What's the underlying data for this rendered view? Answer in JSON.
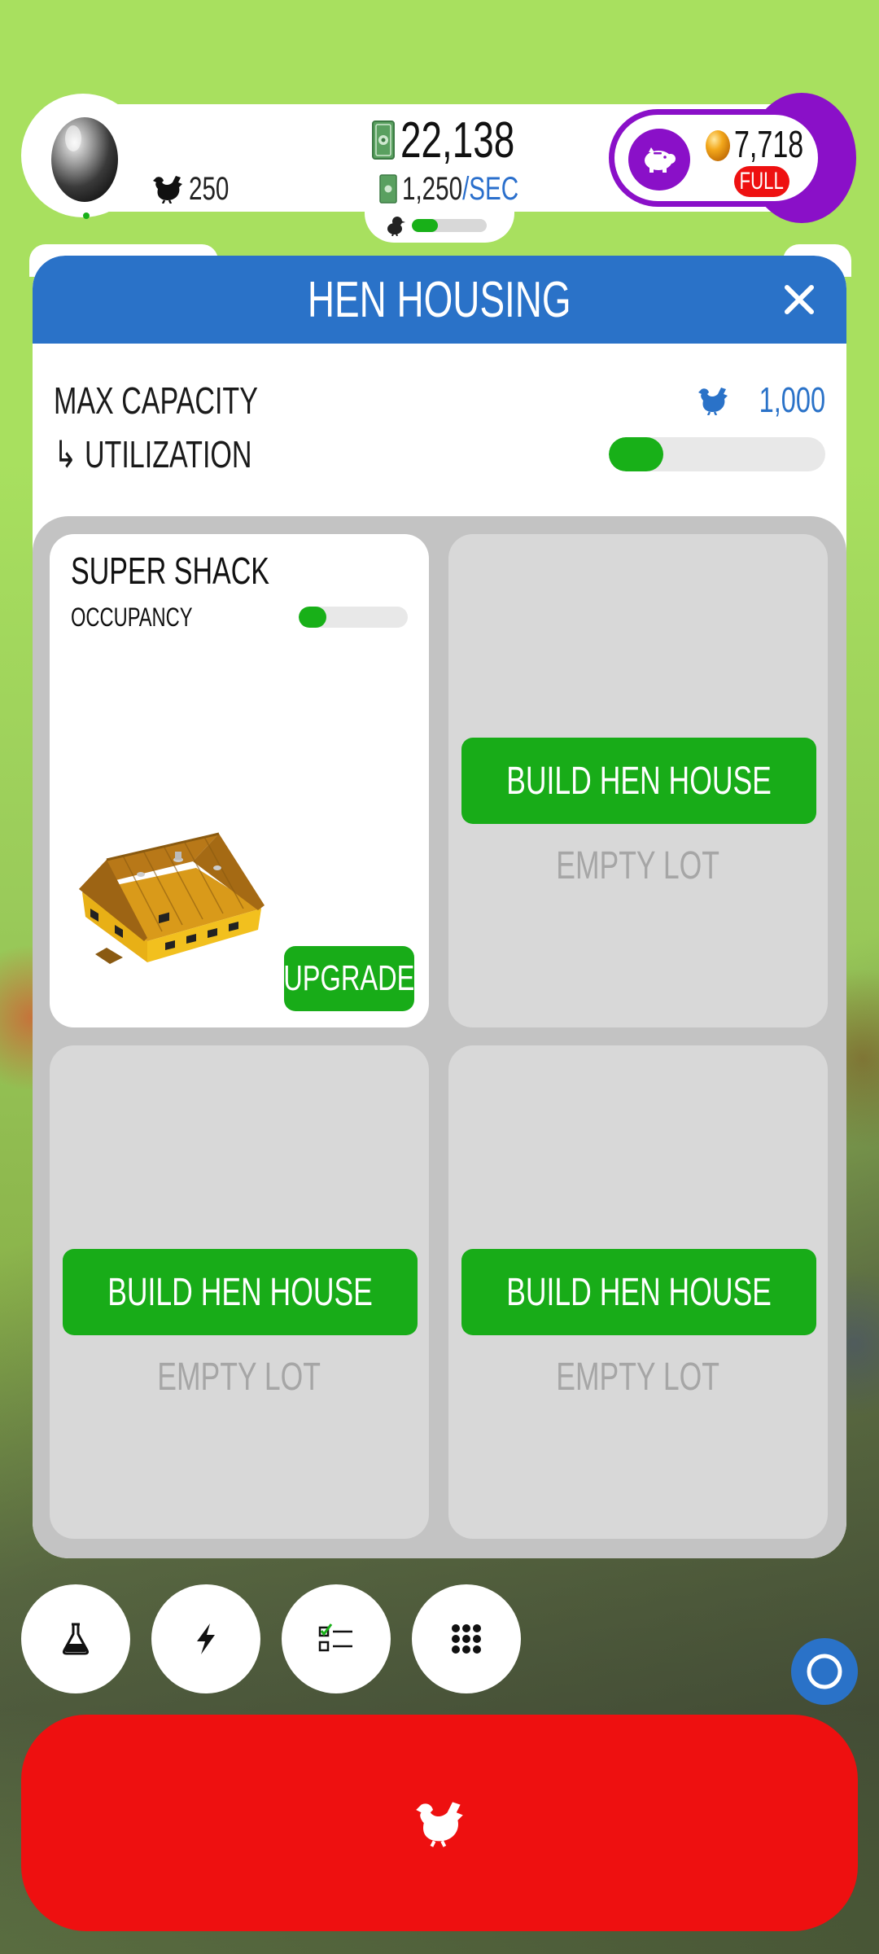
{
  "hud": {
    "hen_count": "250",
    "money": "22,138",
    "rate_value": "1,250",
    "rate_unit": "/SEC",
    "chick_progress": 0.35,
    "golden_eggs": "7,718",
    "bank_status": "FULL"
  },
  "panel": {
    "title": "HEN HOUSING",
    "close_label": "×",
    "max_capacity_label": "MAX CAPACITY",
    "max_capacity_value": "1,000",
    "utilization_label": "↳ UTILIZATION",
    "utilization": 0.25
  },
  "lots": [
    {
      "name": "SUPER SHACK",
      "occupancy_label": "OCCUPANCY",
      "occupancy": 0.25,
      "button": "UPGRADE"
    },
    {
      "button": "BUILD HEN HOUSE",
      "status": "EMPTY LOT"
    },
    {
      "button": "BUILD HEN HOUSE",
      "status": "EMPTY LOT"
    },
    {
      "button": "BUILD HEN HOUSE",
      "status": "EMPTY LOT"
    }
  ],
  "toolbar": {
    "buttons": [
      "flask-icon",
      "lightning-icon",
      "checklist-icon",
      "grid-icon"
    ]
  },
  "colors": {
    "background": "#a8e05f",
    "header_blue": "#2a72c8",
    "action_green": "#18ac18",
    "hatch_red": "#ee1010",
    "bank_purple": "#8a10c8"
  }
}
